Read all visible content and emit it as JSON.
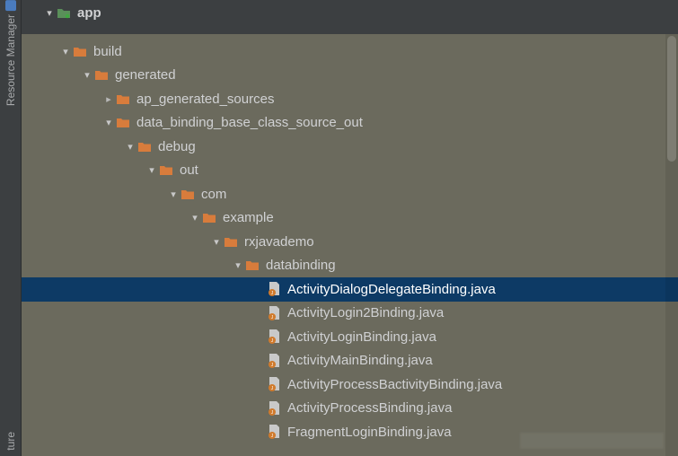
{
  "sidebar": {
    "top_tab": "Resource Manager",
    "bottom_tab": "ture"
  },
  "tree": {
    "module": "app",
    "nodes": [
      {
        "label": "build",
        "depth": 1,
        "type": "folder",
        "arrow": "open"
      },
      {
        "label": "generated",
        "depth": 2,
        "type": "folder",
        "arrow": "open"
      },
      {
        "label": "ap_generated_sources",
        "depth": 3,
        "type": "folder",
        "arrow": "closed"
      },
      {
        "label": "data_binding_base_class_source_out",
        "depth": 3,
        "type": "folder",
        "arrow": "open"
      },
      {
        "label": "debug",
        "depth": 4,
        "type": "folder",
        "arrow": "open"
      },
      {
        "label": "out",
        "depth": 5,
        "type": "folder",
        "arrow": "open"
      },
      {
        "label": "com",
        "depth": 6,
        "type": "folder",
        "arrow": "open"
      },
      {
        "label": "example",
        "depth": 7,
        "type": "folder",
        "arrow": "open"
      },
      {
        "label": "rxjavademo",
        "depth": 8,
        "type": "folder",
        "arrow": "open"
      },
      {
        "label": "databinding",
        "depth": 9,
        "type": "folder",
        "arrow": "open"
      },
      {
        "label": "ActivityDialogDelegateBinding.java",
        "depth": 10,
        "type": "file",
        "arrow": "none",
        "selected": true
      },
      {
        "label": "ActivityLogin2Binding.java",
        "depth": 10,
        "type": "file",
        "arrow": "none"
      },
      {
        "label": "ActivityLoginBinding.java",
        "depth": 10,
        "type": "file",
        "arrow": "none"
      },
      {
        "label": "ActivityMainBinding.java",
        "depth": 10,
        "type": "file",
        "arrow": "none"
      },
      {
        "label": "ActivityProcessBactivityBinding.java",
        "depth": 10,
        "type": "file",
        "arrow": "none"
      },
      {
        "label": "ActivityProcessBinding.java",
        "depth": 10,
        "type": "file",
        "arrow": "none"
      },
      {
        "label": "FragmentLoginBinding.java",
        "depth": 10,
        "type": "file",
        "arrow": "none"
      }
    ]
  },
  "icons": {
    "folder_color": "#d87c3c",
    "module_color": "#5a8f5a",
    "java_badge": "#d07a2c"
  }
}
